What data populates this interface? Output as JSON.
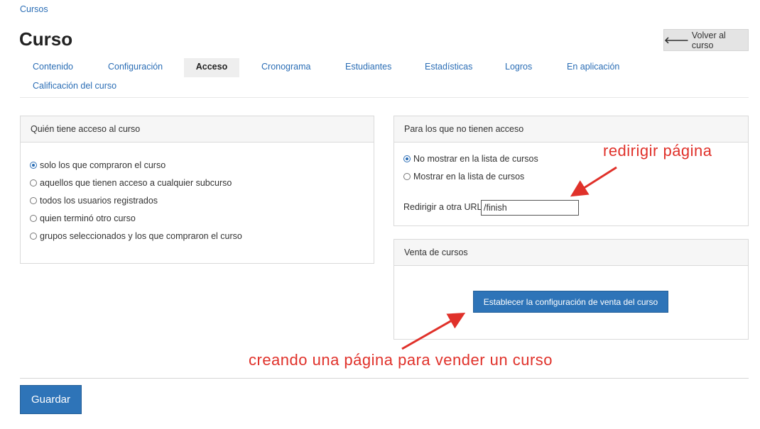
{
  "breadcrumb": {
    "label": "Cursos"
  },
  "page": {
    "title": "Curso",
    "back_label": "Volver al curso",
    "back_icon": "arrow-left-icon"
  },
  "tabs": [
    {
      "label": "Contenido",
      "active": false
    },
    {
      "label": "Configuración",
      "active": false
    },
    {
      "label": "Acceso",
      "active": true
    },
    {
      "label": "Cronograma",
      "active": false
    },
    {
      "label": "Estudiantes",
      "active": false
    },
    {
      "label": "Estadísticas",
      "active": false
    },
    {
      "label": "Logros",
      "active": false
    },
    {
      "label": "En aplicación",
      "active": false
    },
    {
      "label": "Calificación del curso",
      "active": false
    }
  ],
  "access_panel": {
    "header": "Quién tiene acceso al curso",
    "options": [
      {
        "label": "solo los que compraron el curso",
        "checked": true
      },
      {
        "label": "aquellos que tienen acceso a cualquier subcurso",
        "checked": false
      },
      {
        "label": "todos los usuarios registrados",
        "checked": false
      },
      {
        "label": "quien terminó otro curso",
        "checked": false
      },
      {
        "label": "grupos seleccionados y los que compraron el curso",
        "checked": false
      }
    ]
  },
  "no_access_panel": {
    "header": "Para los que no tienen acceso",
    "options": [
      {
        "label": "No mostrar en la lista de cursos",
        "checked": true
      },
      {
        "label": "Mostrar en la lista de cursos",
        "checked": false
      }
    ],
    "redirect_label": "Redirigir a otra URL",
    "redirect_value": "/finish"
  },
  "sales_panel": {
    "header": "Venta de cursos",
    "button_label": "Establecer la configuración de venta del curso"
  },
  "save_label": "Guardar",
  "annotations": {
    "redirect_note": "redirigir página",
    "sale_note": "creando una página para vender un curso",
    "color": "#e0312a"
  },
  "colors": {
    "accent": "#2e74b8",
    "link": "#2a6db5"
  }
}
